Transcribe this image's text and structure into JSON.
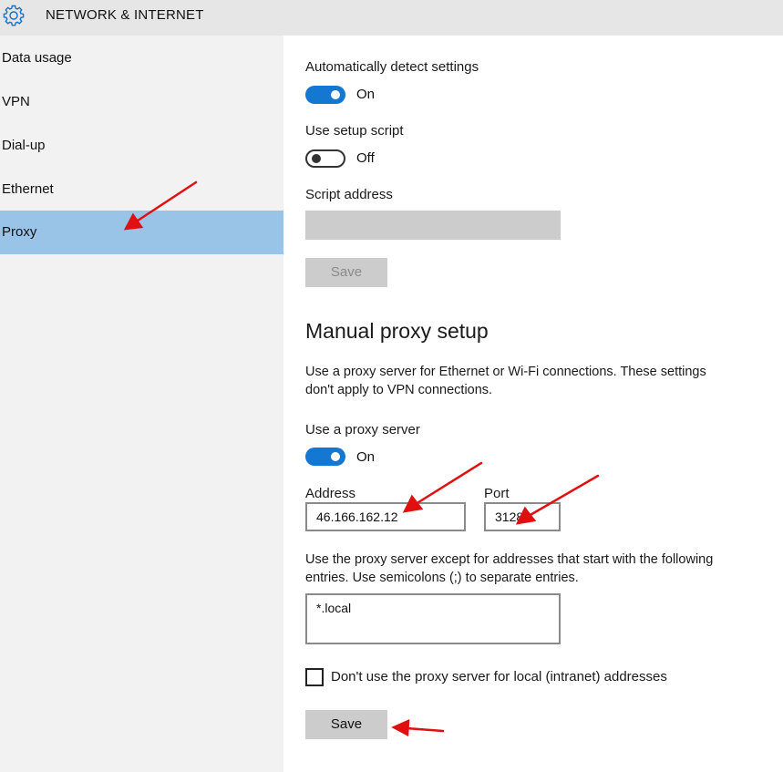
{
  "header": {
    "title": "NETWORK & INTERNET",
    "icon": "gear-icon"
  },
  "sidebar": {
    "items": [
      {
        "label": "Data usage",
        "selected": false
      },
      {
        "label": "VPN",
        "selected": false
      },
      {
        "label": "Dial-up",
        "selected": false
      },
      {
        "label": "Ethernet",
        "selected": false
      },
      {
        "label": "Proxy",
        "selected": true
      }
    ],
    "selected_color": "#99c3e7"
  },
  "automatic": {
    "detect_label": "Automatically detect settings",
    "detect_state": "On",
    "script_label": "Use setup script",
    "script_state": "Off",
    "address_label": "Script address",
    "address_value": "",
    "save_label": "Save"
  },
  "manual": {
    "heading": "Manual proxy setup",
    "description": "Use a proxy server for Ethernet or Wi-Fi connections. These settings don't apply to VPN connections.",
    "use_proxy_label": "Use a proxy server",
    "use_proxy_state": "On",
    "address_label": "Address",
    "address_value": "46.166.162.12",
    "port_label": "Port",
    "port_value": "3128",
    "exceptions_description": "Use the proxy server except for addresses that start with the following entries. Use semicolons (;) to separate entries.",
    "exceptions_value": "*.local",
    "local_checkbox_label": "Don't use the proxy server for local (intranet) addresses",
    "local_checkbox_checked": false,
    "save_label": "Save"
  },
  "colors": {
    "accent": "#1478d2",
    "annotation_arrow": "#e01010"
  }
}
